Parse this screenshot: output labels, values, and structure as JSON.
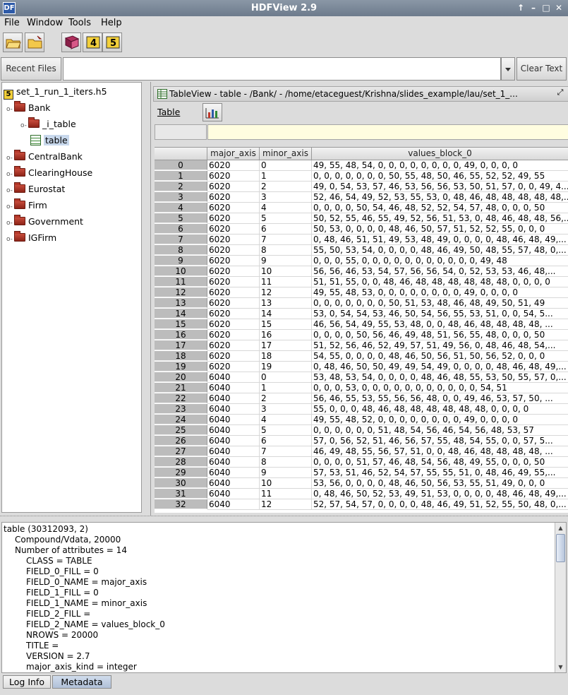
{
  "window": {
    "title": "HDFView 2.9"
  },
  "menu": [
    "File",
    "Window",
    "Tools",
    "Help"
  ],
  "toolbar": {
    "icons": [
      "open-file-icon",
      "open-folder-icon",
      "help-book-icon",
      "hdf4-icon",
      "hdf5-icon"
    ],
    "hdf4_label": "4",
    "hdf5_label": "5"
  },
  "recent": {
    "label": "Recent Files",
    "value": "",
    "clear_label": "Clear Text"
  },
  "tree": {
    "root": "set_1_run_1_iters.h5",
    "nodes": [
      {
        "label": "Bank",
        "level": 1,
        "expanded": true
      },
      {
        "label": "_i_table",
        "level": 2,
        "expanded": false
      },
      {
        "label": "table",
        "level": 2,
        "selected": true
      },
      {
        "label": "CentralBank",
        "level": 1,
        "expanded": false
      },
      {
        "label": "ClearingHouse",
        "level": 1,
        "expanded": false
      },
      {
        "label": "Eurostat",
        "level": 1,
        "expanded": false
      },
      {
        "label": "Firm",
        "level": 1,
        "expanded": false
      },
      {
        "label": "Government",
        "level": 1,
        "expanded": false
      },
      {
        "label": "IGFirm",
        "level": 1,
        "expanded": false
      }
    ]
  },
  "tableview": {
    "title": "TableView  -  table  -  /Bank/  -  /home/etaceguest/Krishna/slides_example/lau/set_1_...",
    "menu_label": "Table",
    "columns": [
      "major_axis",
      "minor_axis",
      "values_block_0"
    ],
    "rows": [
      [
        "0",
        "6020",
        "0",
        "49, 55, 48, 54, 0, 0, 0, 0, 0, 0, 0, 0, 49, 0, 0, 0, 0"
      ],
      [
        "1",
        "6020",
        "1",
        "0, 0, 0, 0, 0, 0, 0, 50, 55, 48, 50, 46, 55, 52, 52, 49, 55"
      ],
      [
        "2",
        "6020",
        "2",
        "49, 0, 54, 53, 57, 46, 53, 56, 56, 53, 50, 51, 57, 0, 0, 49, 4..."
      ],
      [
        "3",
        "6020",
        "3",
        "52, 46, 54, 49, 52, 53, 55, 53, 0, 48, 46, 48, 48, 48, 48, 48,..."
      ],
      [
        "4",
        "6020",
        "4",
        "0, 0, 0, 0, 50, 54, 46, 48, 52, 52, 54, 57, 48, 0, 0, 0, 50"
      ],
      [
        "5",
        "6020",
        "5",
        "50, 52, 55, 46, 55, 49, 52, 56, 51, 53, 0, 48, 46, 48, 48, 56,..."
      ],
      [
        "6",
        "6020",
        "6",
        "50, 53, 0, 0, 0, 0, 48, 46, 50, 57, 51, 52, 52, 55, 0, 0, 0"
      ],
      [
        "7",
        "6020",
        "7",
        "0, 48, 46, 51, 51, 49, 53, 48, 49, 0, 0, 0, 0, 48, 46, 48, 49,..."
      ],
      [
        "8",
        "6020",
        "8",
        "55, 50, 53, 54, 0, 0, 0, 0, 48, 46, 49, 50, 48, 55, 57, 48, 0,..."
      ],
      [
        "9",
        "6020",
        "9",
        "0, 0, 0, 55, 0, 0, 0, 0, 0, 0, 0, 0, 0, 0, 0, 49, 48"
      ],
      [
        "10",
        "6020",
        "10",
        "56, 56, 46, 53, 54, 57, 56, 56, 54, 0, 52, 53, 53, 46, 48,..."
      ],
      [
        "11",
        "6020",
        "11",
        "51, 51, 55, 0, 0, 48, 46, 48, 48, 48, 48, 48, 48, 0, 0, 0, 0"
      ],
      [
        "12",
        "6020",
        "12",
        "49, 55, 48, 53, 0, 0, 0, 0, 0, 0, 0, 0, 49, 0, 0, 0, 0"
      ],
      [
        "13",
        "6020",
        "13",
        "0, 0, 0, 0, 0, 0, 0, 50, 51, 53, 48, 46, 48, 49, 50, 51, 49"
      ],
      [
        "14",
        "6020",
        "14",
        "53, 0, 54, 54, 53, 46, 50, 54, 56, 55, 53, 51, 0, 0, 54, 5..."
      ],
      [
        "15",
        "6020",
        "15",
        "46, 56, 54, 49, 55, 53, 48, 0, 0, 48, 46, 48, 48, 48, 48, ..."
      ],
      [
        "16",
        "6020",
        "16",
        "0, 0, 0, 0, 50, 56, 46, 49, 48, 51, 56, 55, 48, 0, 0, 0, 50"
      ],
      [
        "17",
        "6020",
        "17",
        "51, 52, 56, 46, 52, 49, 57, 51, 49, 56, 0, 48, 46, 48, 54,..."
      ],
      [
        "18",
        "6020",
        "18",
        "54, 55, 0, 0, 0, 0, 48, 46, 50, 56, 51, 50, 56, 52, 0, 0, 0"
      ],
      [
        "19",
        "6020",
        "19",
        "0, 48, 46, 50, 50, 49, 49, 54, 49, 0, 0, 0, 0, 48, 46, 48, 49,..."
      ],
      [
        "20",
        "6040",
        "0",
        "53, 48, 53, 54, 0, 0, 0, 0, 48, 46, 48, 55, 53, 50, 55, 57, 0,..."
      ],
      [
        "21",
        "6040",
        "1",
        "0, 0, 0, 53, 0, 0, 0, 0, 0, 0, 0, 0, 0, 0, 0, 54, 51"
      ],
      [
        "22",
        "6040",
        "2",
        "56, 46, 55, 53, 55, 56, 56, 48, 0, 0, 49, 46, 53, 57, 50, ..."
      ],
      [
        "23",
        "6040",
        "3",
        "55, 0, 0, 0, 48, 46, 48, 48, 48, 48, 48, 48, 0, 0, 0, 0"
      ],
      [
        "24",
        "6040",
        "4",
        "49, 55, 48, 52, 0, 0, 0, 0, 0, 0, 0, 0, 49, 0, 0, 0, 0"
      ],
      [
        "25",
        "6040",
        "5",
        "0, 0, 0, 0, 0, 0, 51, 48, 54, 56, 46, 54, 56, 48, 53, 57"
      ],
      [
        "26",
        "6040",
        "6",
        "57, 0, 56, 52, 51, 46, 56, 57, 55, 48, 54, 55, 0, 0, 57, 5..."
      ],
      [
        "27",
        "6040",
        "7",
        "46, 49, 48, 55, 56, 57, 51, 0, 0, 48, 46, 48, 48, 48, 48, ..."
      ],
      [
        "28",
        "6040",
        "8",
        "0, 0, 0, 0, 51, 57, 46, 48, 54, 56, 48, 49, 55, 0, 0, 0, 50"
      ],
      [
        "29",
        "6040",
        "9",
        "57, 53, 51, 46, 52, 54, 57, 55, 55, 51, 0, 48, 46, 49, 55,..."
      ],
      [
        "30",
        "6040",
        "10",
        "53, 56, 0, 0, 0, 0, 48, 46, 50, 56, 53, 55, 51, 49, 0, 0, 0"
      ],
      [
        "31",
        "6040",
        "11",
        "0, 48, 46, 50, 52, 53, 49, 51, 53, 0, 0, 0, 0, 48, 46, 48, 49,..."
      ],
      [
        "32",
        "6040",
        "12",
        "52, 57, 54, 57, 0, 0, 0, 0, 48, 46, 49, 51, 52, 55, 50, 48, 0,..."
      ]
    ]
  },
  "info": {
    "lines": [
      {
        "text": "table (30312093, 2)",
        "indent": 0
      },
      {
        "text": "Compound/Vdata,    20000",
        "indent": 1
      },
      {
        "text": "Number of attributes = 14",
        "indent": 1
      },
      {
        "text": "CLASS = TABLE",
        "indent": 2
      },
      {
        "text": "FIELD_0_FILL = 0",
        "indent": 2
      },
      {
        "text": "FIELD_0_NAME = major_axis",
        "indent": 2
      },
      {
        "text": "FIELD_1_FILL = 0",
        "indent": 2
      },
      {
        "text": "FIELD_1_NAME = minor_axis",
        "indent": 2
      },
      {
        "text": "FIELD_2_FILL =",
        "indent": 2
      },
      {
        "text": "FIELD_2_NAME = values_block_0",
        "indent": 2
      },
      {
        "text": "NROWS = 20000",
        "indent": 2
      },
      {
        "text": "TITLE =",
        "indent": 2
      },
      {
        "text": "VERSION = 2.7",
        "indent": 2
      },
      {
        "text": "major_axis_kind = integer",
        "indent": 2
      }
    ]
  },
  "tabs": [
    {
      "label": "Log Info",
      "active": true
    },
    {
      "label": "Metadata",
      "active": false
    }
  ]
}
